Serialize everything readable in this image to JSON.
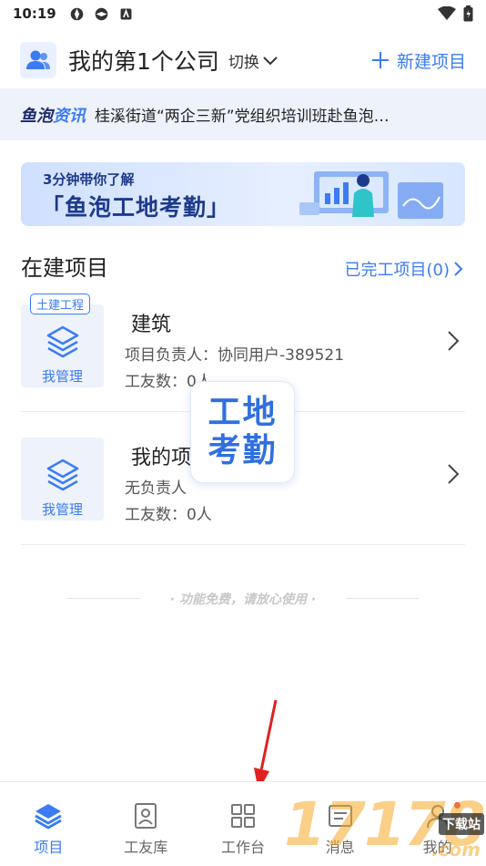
{
  "status_bar": {
    "time": "10:19"
  },
  "header": {
    "company": "我的第1个公司",
    "switch_label": "切换",
    "new_project_label": "新建项目"
  },
  "news": {
    "brand_a": "鱼泡",
    "brand_b": "资讯",
    "text": "桂溪街道“两企三新”党组织培训班赴鱼泡…"
  },
  "banner": {
    "subtitle": "3分钟带你了解",
    "title": "「鱼泡工地考勤」"
  },
  "section": {
    "title": "在建项目",
    "completed_link": "已完工项目(0)"
  },
  "projects": [
    {
      "tag": "土建工程",
      "manage_label": "我管理",
      "name": "建筑",
      "leader": "项目负责人：协同用户-389521",
      "workers": "工友数：0人"
    },
    {
      "tag": "",
      "manage_label": "我管理",
      "name": "我的项",
      "leader": "无负责人",
      "workers": "工友数：0人"
    }
  ],
  "floating_badge": {
    "line1": "工地",
    "line2": "考勤"
  },
  "free_note": "· 功能免费，请放心使用 ·",
  "nav": [
    {
      "label": "项目",
      "icon": "layers-icon",
      "active": true
    },
    {
      "label": "工友库",
      "icon": "contact-card-icon",
      "active": false
    },
    {
      "label": "工作台",
      "icon": "grid-icon",
      "active": false
    },
    {
      "label": "消息",
      "icon": "message-icon",
      "active": false
    },
    {
      "label": "我的",
      "icon": "user-icon",
      "active": false
    }
  ],
  "watermark": {
    "number": "17178",
    "badge": "下载站",
    "domain": ".com"
  },
  "colors": {
    "accent": "#3b7cf3",
    "news_bg": "#eef2fb",
    "annotation_arrow": "#e02020"
  }
}
